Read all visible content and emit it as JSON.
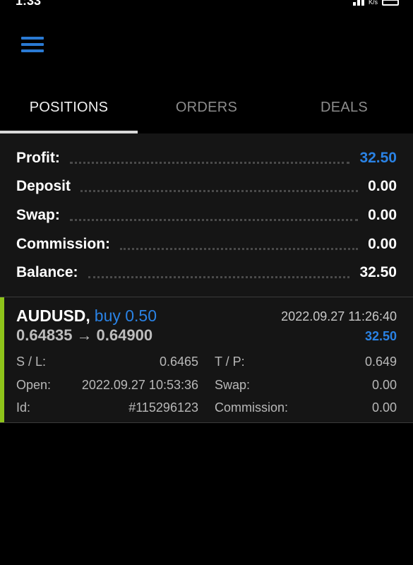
{
  "status_bar": {
    "time": "1:33",
    "speed": "K/s"
  },
  "header": {
    "menu_icon": "hamburger-menu-icon"
  },
  "tabs": [
    {
      "label": "POSITIONS",
      "active": true
    },
    {
      "label": "ORDERS",
      "active": false
    },
    {
      "label": "DEALS",
      "active": false
    }
  ],
  "summary": {
    "profit": {
      "label": "Profit:",
      "value": "32.50"
    },
    "deposit": {
      "label": "Deposit",
      "value": "0.00"
    },
    "swap": {
      "label": "Swap:",
      "value": "0.00"
    },
    "commission": {
      "label": "Commission:",
      "value": "0.00"
    },
    "balance": {
      "label": "Balance:",
      "value": "32.50"
    }
  },
  "position": {
    "symbol": "AUDUSD",
    "comma": ",",
    "side": "buy 0.50",
    "time": "2022.09.27 11:26:40",
    "open_price": "0.64835",
    "arrow": "→",
    "current_price": "0.64900",
    "profit": "32.50",
    "sl_label": "S / L:",
    "sl_value": "0.6465",
    "tp_label": "T / P:",
    "tp_value": "0.649",
    "open_label": "Open:",
    "open_value": "2022.09.27 10:53:36",
    "swap_label": "Swap:",
    "swap_value": "0.00",
    "id_label": "Id:",
    "id_value": "#115296123",
    "commission_label": "Commission:",
    "commission_value": "0.00"
  },
  "colors": {
    "accent_blue": "#2a82e4",
    "buy_bar": "#8ec31a"
  }
}
